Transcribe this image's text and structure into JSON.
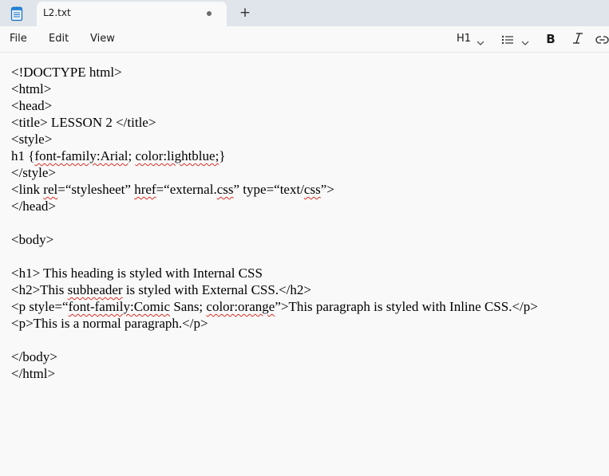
{
  "tab": {
    "title": "L2.txt",
    "unsaved": true
  },
  "menu": {
    "file": "File",
    "edit": "Edit",
    "view": "View"
  },
  "toolbar": {
    "heading_label": "H1",
    "bold_label": "B"
  },
  "icons": {
    "app": "notepad-icon",
    "new_tab": "plus-icon",
    "list": "bulleted-list-icon",
    "italic": "italic-icon",
    "link": "link-icon",
    "chevron": "chevron-down-icon"
  },
  "editor": {
    "lines": [
      "<!DOCTYPE html>",
      "<html>",
      "<head>",
      "<title> LESSON 2 </title>",
      "<style>",
      "h1 {font-family:Arial; color:lightblue;}",
      "</style>",
      "<link rel=“stylesheet” href=“external.css” type=“text/css”>",
      "</head>",
      "",
      "<body>",
      "",
      "<h1> This heading is styled with Internal CSS",
      "<h2>This subheader is styled with External CSS.</h2>",
      "<p style=“font-family:Comic Sans; color:orange”>This paragraph is styled with Inline CSS.</p>",
      "<p>This is a normal paragraph.</p>",
      "",
      "</body>",
      "</html>"
    ],
    "misspelled": [
      "font-family:Arial",
      "color:lightblue;",
      "rel",
      "href",
      "css",
      "subheader",
      "font-family:Comic",
      "color:orange"
    ]
  },
  "colors": {
    "tab_strip": "#dfe5ea",
    "surface": "#f9f9f9",
    "spellcheck_underline": "#d93025"
  }
}
